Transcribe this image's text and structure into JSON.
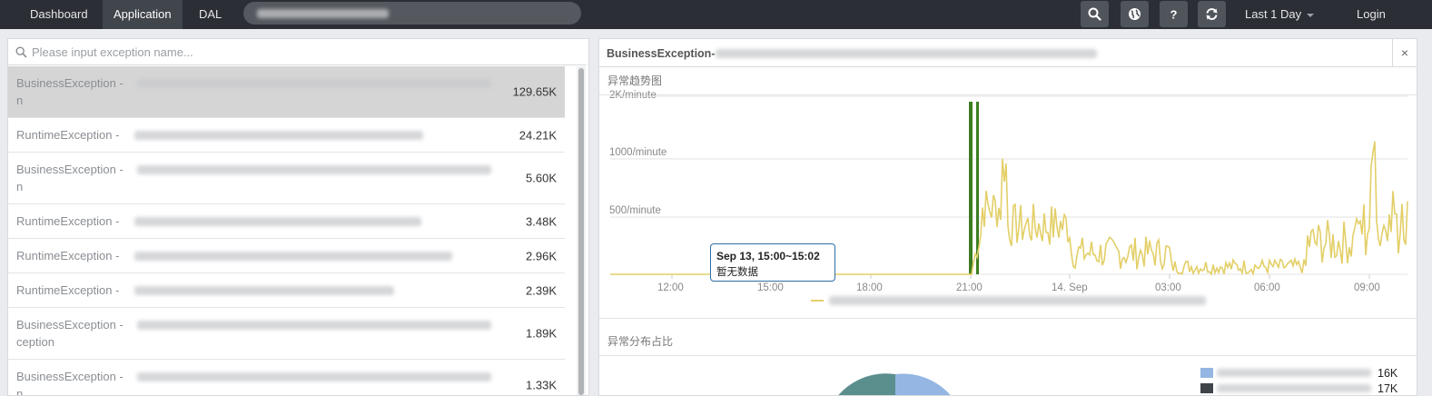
{
  "nav": {
    "dashboard": "Dashboard",
    "application": "Application",
    "dal": "DAL",
    "time_range": "Last 1 Day",
    "login": "Login"
  },
  "search": {
    "placeholder": "Please input exception name..."
  },
  "exceptions": [
    {
      "prefix": "BusinessException - ",
      "wrap": "n",
      "count": "129.65K",
      "selected": true
    },
    {
      "prefix": "RuntimeException - ",
      "wrap": "",
      "count": "24.21K",
      "selected": false
    },
    {
      "prefix": "BusinessException - ",
      "wrap": "n",
      "count": "5.60K",
      "selected": false
    },
    {
      "prefix": "RuntimeException - ",
      "wrap": "",
      "count": "3.48K",
      "selected": false
    },
    {
      "prefix": "RuntimeException - ",
      "wrap": "",
      "count": "2.96K",
      "selected": false
    },
    {
      "prefix": "RuntimeException - ",
      "wrap": "",
      "count": "2.39K",
      "selected": false
    },
    {
      "prefix": "BusinessException - ",
      "wrap": "ception",
      "count": "1.89K",
      "selected": false
    },
    {
      "prefix": "BusinessException - ",
      "wrap": "n",
      "count": "1.33K",
      "selected": false
    }
  ],
  "detail": {
    "title": "BusinessException-",
    "close": "×",
    "trend_title": "异常趋势图",
    "dist_title": "异常分布占比"
  },
  "chart_data": {
    "type": "line",
    "y_ticks": [
      "2K/minute",
      "1000/minute",
      "500/minute"
    ],
    "ylim": [
      0,
      1500
    ],
    "x_ticks": [
      "12:00",
      "15:00",
      "18:00",
      "21:00",
      "14. Sep",
      "03:00",
      "06:00",
      "09:00"
    ],
    "tooltip_time": "Sep 13, 15:00~15:02",
    "tooltip_text": "暂无数据",
    "series_color": "#e3cf68",
    "marker_color": "#3c7d22"
  },
  "distribution": {
    "legend": [
      {
        "value": "16K",
        "color": "#95b6e3"
      },
      {
        "value": "17K",
        "color": "#3f434a"
      }
    ],
    "pie_colors": [
      "#95b6e3",
      "#5b8f8e"
    ]
  }
}
